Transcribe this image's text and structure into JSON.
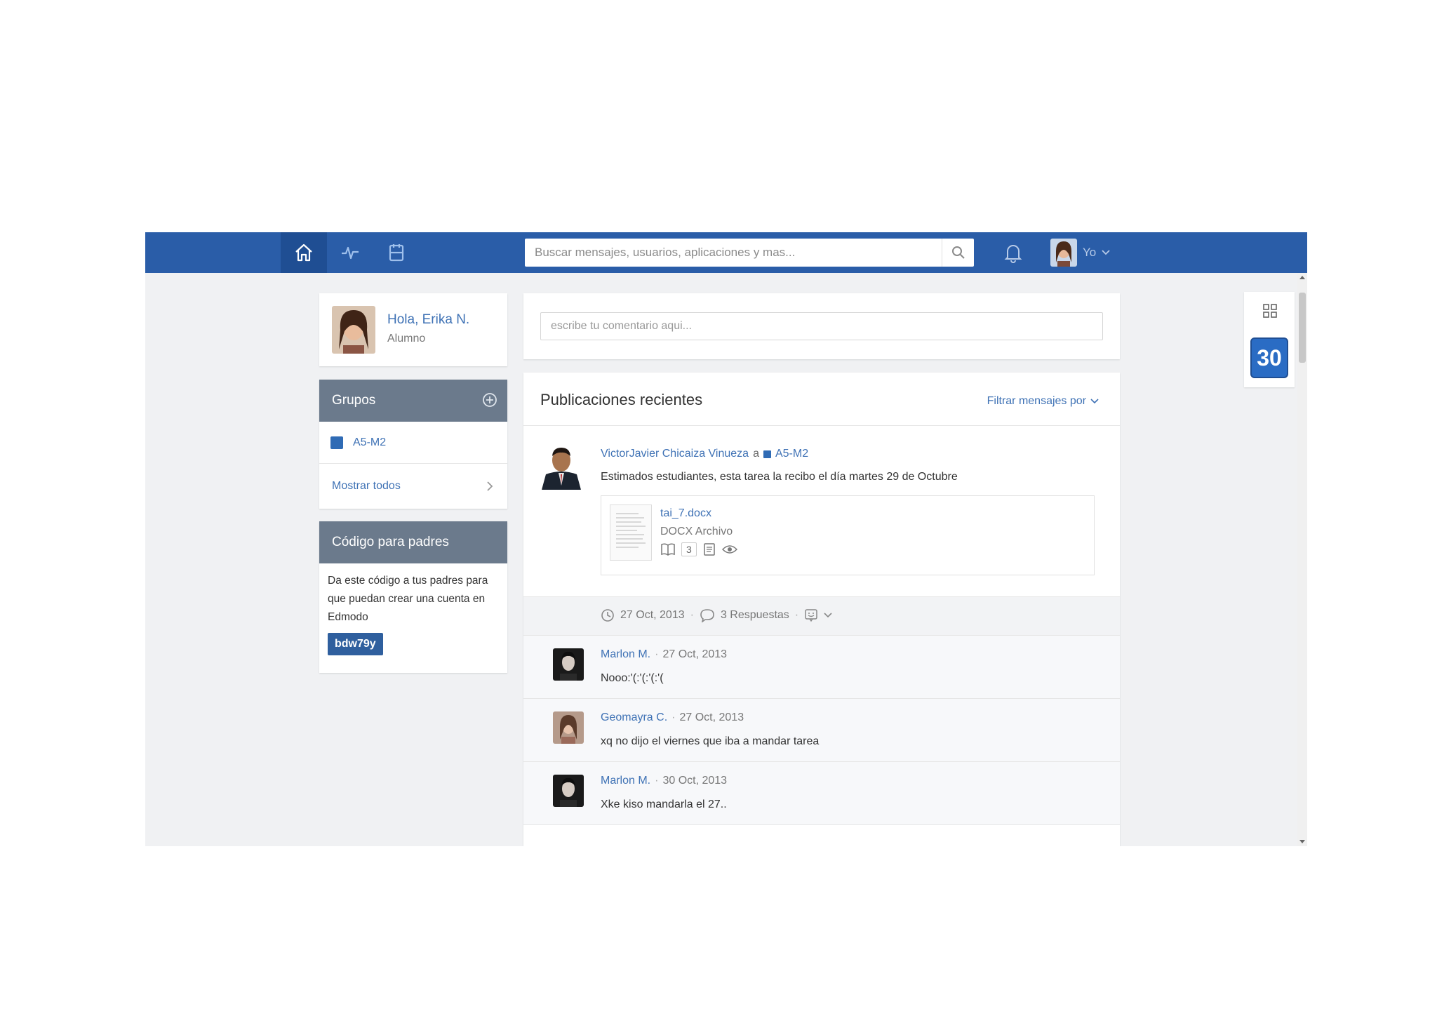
{
  "nav": {
    "search_placeholder": "Buscar mensajes, usuarios, aplicaciones y mas...",
    "user_label": "Yo",
    "icons": [
      "home-icon",
      "activity-icon",
      "planner-icon",
      "search-icon",
      "bell-icon",
      "chevron-down-icon"
    ]
  },
  "profile": {
    "greeting": "Hola, Erika N.",
    "role": "Alumno"
  },
  "groups": {
    "title": "Grupos",
    "items": [
      {
        "name": "A5-M2"
      }
    ],
    "show_all": "Mostrar todos"
  },
  "parents": {
    "title": "Código para padres",
    "description": "Da este código a tus padres para que puedan crear una cuenta en Edmodo",
    "code": "bdw79y"
  },
  "composer": {
    "placeholder": "escribe tu comentario aqui..."
  },
  "feed": {
    "title": "Publicaciones recientes",
    "filter_label": "Filtrar mensajes por",
    "post": {
      "author": "VictorJavier Chicaiza Vinueza",
      "to_word": "a",
      "group": "A5-M2",
      "text": "Estimados estudiantes, esta tarea la recibo el día martes 29 de Octubre",
      "attachment": {
        "filename": "tai_7.docx",
        "type": "DOCX Archivo",
        "count": "3"
      },
      "date": "27 Oct, 2013",
      "replies_label": "3 Respuestas"
    },
    "replies": [
      {
        "author": "Marlon M.",
        "date": "27 Oct, 2013",
        "text": "Nooo:'(:'(:'(:'("
      },
      {
        "author": "Geomayra C.",
        "date": "27 Oct, 2013",
        "text": "xq no dijo el viernes que iba a mandar tarea"
      },
      {
        "author": "Marlon M.",
        "date": "30 Oct, 2013",
        "text": "Xke kiso mandarla el 27.."
      }
    ]
  },
  "calendar": {
    "day": "30"
  },
  "colors": {
    "topbar": "#2a5da8",
    "link": "#3f72b5",
    "panel_head": "#6b7a8c",
    "code_bg": "#2f5f9e"
  }
}
